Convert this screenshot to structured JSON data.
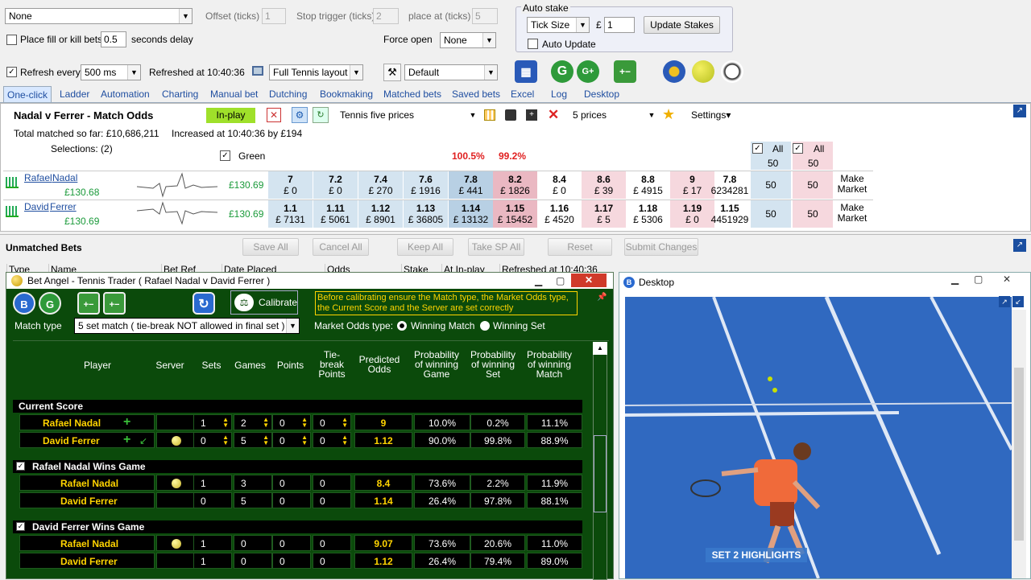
{
  "top": {
    "none_select": "None",
    "offset_label": "Offset (ticks)",
    "offset_val": "1",
    "stop_label": "Stop trigger (ticks)",
    "stop_val": "2",
    "place_label": "place at (ticks)",
    "place_val": "5",
    "fill_kill_label": "Place fill or kill bets",
    "fill_kill_val": "0.5",
    "delay_label": "seconds delay",
    "force_open_label": "Force open",
    "force_open_val": "None",
    "auto_stake_title": "Auto stake",
    "tick_size": "Tick Size",
    "pound": "£",
    "stake_val": "1",
    "update_stakes": "Update Stakes",
    "auto_update": "Auto Update",
    "refresh_label": "Refresh every",
    "refresh_val": "500 ms",
    "refreshed_at": "Refreshed at 10:40:36",
    "layout_val": "Full Tennis layout",
    "default_val": "Default",
    "tb_g": "G",
    "tb_gplus": "G+"
  },
  "tabs": [
    "One-click",
    "Ladder",
    "Automation",
    "Charting",
    "Manual bet",
    "Dutching",
    "Bookmaking",
    "Matched bets",
    "Saved bets",
    "Excel",
    "Log",
    "Desktop"
  ],
  "market": {
    "title": "Nadal v Ferrer - Match Odds",
    "inplay": "In-play",
    "prices_select": "Tennis five prices",
    "num_prices": "5 prices",
    "settings": "Settings",
    "total_matched": "Total matched so far: £10,686,211",
    "increased": "Increased at 10:40:36 by £194",
    "selections": "Selections: (2)",
    "green_label": "Green",
    "pct_back": "100.5%",
    "pct_lay": "99.2%",
    "all_back": "All",
    "all_lay": "All",
    "stake_back": "50",
    "stake_lay": "50"
  },
  "runners": [
    {
      "first": "Rafael",
      "last": "Nadal",
      "pl": "£130.68",
      "green": "£130.69",
      "back": [
        [
          "7",
          "£ 0"
        ],
        [
          "7.2",
          "£ 0"
        ],
        [
          "7.4",
          "£ 270"
        ],
        [
          "7.6",
          "£ 1916"
        ],
        [
          "7.8",
          "£ 441"
        ]
      ],
      "lay": [
        [
          "8.2",
          "£ 1826"
        ],
        [
          "8.4",
          "£ 0"
        ],
        [
          "8.6",
          "£ 39"
        ],
        [
          "8.8",
          "£ 4915"
        ],
        [
          "9",
          "£ 17"
        ]
      ],
      "ltp": "7.8",
      "vol": "6234281",
      "sb": "50",
      "sl": "50",
      "mm": "Make Market"
    },
    {
      "first": "David",
      "last": "Ferrer",
      "pl": "£130.69",
      "green": "£130.69",
      "back": [
        [
          "1.1",
          "£ 7131"
        ],
        [
          "1.11",
          "£ 5061"
        ],
        [
          "1.12",
          "£ 8901"
        ],
        [
          "1.13",
          "£ 36805"
        ],
        [
          "1.14",
          "£ 13132"
        ]
      ],
      "lay": [
        [
          "1.15",
          "£ 15452"
        ],
        [
          "1.16",
          "£ 4520"
        ],
        [
          "1.17",
          "£ 5"
        ],
        [
          "1.18",
          "£ 5306"
        ],
        [
          "1.19",
          "£ 0"
        ]
      ],
      "ltp": "1.15",
      "vol": "4451929",
      "sb": "50",
      "sl": "50",
      "mm": "Make Market"
    }
  ],
  "unmatched": {
    "title": "Unmatched Bets",
    "save_all": "Save All",
    "cancel_all": "Cancel All",
    "keep_all": "Keep All",
    "take_sp": "Take SP All",
    "reset": "Reset",
    "submit": "Submit Changes",
    "cols": [
      "Type",
      "Name",
      "Bet Ref",
      "Date Placed",
      "Odds",
      "Stake",
      "At In-play",
      "Refreshed at 10:40:36"
    ]
  },
  "trader": {
    "title": "Bet Angel - Tennis Trader ( Rafael Nadal v David Ferrer )",
    "calibrate": "Calibrate",
    "notice": "Before calibrating ensure the Match type, the Market Odds type, the Current Score and the Server are set correctly",
    "match_type_label": "Match type",
    "match_type_val": "5 set match ( tie-break NOT allowed in final set )",
    "odds_type_label": "Market Odds type:",
    "opt1": "Winning Match",
    "opt2": "Winning Set",
    "headers": {
      "player": "Player",
      "server": "Server",
      "sets": "Sets",
      "games": "Games",
      "points": "Points",
      "tb": "Tie-break Points",
      "pred": "Predicted Odds",
      "pgame": "Probability of winning Game",
      "pset": "Probability of winning Set",
      "pmatch": "Probability of winning Match"
    },
    "sections": [
      {
        "title": "Current Score",
        "check": false,
        "rows": [
          {
            "name": "Rafael Nadal",
            "server": false,
            "sets": "1",
            "games": "2",
            "points": "0",
            "tb": "0",
            "pred": "9",
            "pg": "10.0%",
            "ps": "0.2%",
            "pm": "11.1%"
          },
          {
            "name": "David Ferrer",
            "server": true,
            "sets": "0",
            "games": "5",
            "points": "0",
            "tb": "0",
            "pred": "1.12",
            "pg": "90.0%",
            "ps": "99.8%",
            "pm": "88.9%"
          }
        ]
      },
      {
        "title": "Rafael Nadal Wins Game",
        "check": true,
        "rows": [
          {
            "name": "Rafael Nadal",
            "server": true,
            "sets": "1",
            "games": "3",
            "points": "0",
            "tb": "0",
            "pred": "8.4",
            "pg": "73.6%",
            "ps": "2.2%",
            "pm": "11.9%"
          },
          {
            "name": "David Ferrer",
            "server": false,
            "sets": "0",
            "games": "5",
            "points": "0",
            "tb": "0",
            "pred": "1.14",
            "pg": "26.4%",
            "ps": "97.8%",
            "pm": "88.1%"
          }
        ]
      },
      {
        "title": "David Ferrer Wins Game",
        "check": true,
        "rows": [
          {
            "name": "Rafael Nadal",
            "server": true,
            "sets": "1",
            "games": "0",
            "points": "0",
            "tb": "0",
            "pred": "9.07",
            "pg": "73.6%",
            "ps": "20.6%",
            "pm": "11.0%"
          },
          {
            "name": "David Ferrer",
            "server": false,
            "sets": "1",
            "games": "0",
            "points": "0",
            "tb": "0",
            "pred": "1.12",
            "pg": "26.4%",
            "ps": "79.4%",
            "pm": "89.0%"
          }
        ]
      }
    ]
  },
  "desktop": {
    "title": "Desktop",
    "overlay": "SET 2 HIGHLIGHTS"
  }
}
